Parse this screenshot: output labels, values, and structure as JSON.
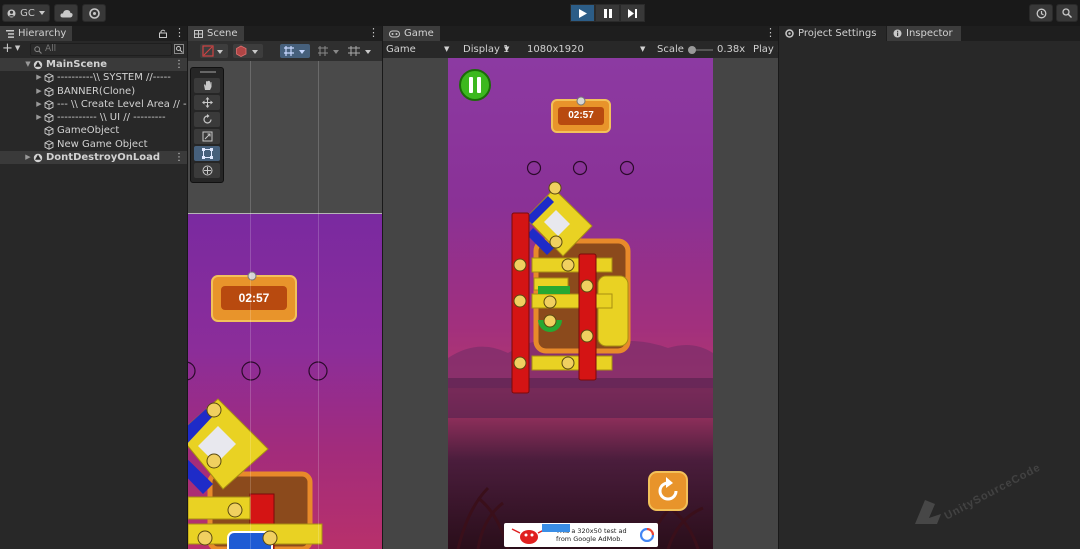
{
  "toolbar": {
    "account_label": "GC",
    "cloud_icon": "cloud-icon",
    "settings_icon": "gear-icon",
    "play_icon": "play-icon",
    "pause_icon": "pause-icon",
    "step_icon": "step-icon",
    "history_icon": "history-icon",
    "search_icon": "search-icon"
  },
  "hierarchy": {
    "tab_label": "Hierarchy",
    "search_placeholder": "All",
    "items": [
      {
        "label": "MainScene",
        "depth": 0,
        "type": "scene",
        "expanded": true
      },
      {
        "label": "----------\\\\ SYSTEM //-----",
        "depth": 1,
        "type": "object",
        "expandable": true
      },
      {
        "label": "BANNER(Clone)",
        "depth": 1,
        "type": "object",
        "expandable": true
      },
      {
        "label": "--- \\\\ Create Level Area // --",
        "depth": 1,
        "type": "object",
        "expandable": true
      },
      {
        "label": "----------- \\\\ UI // ---------",
        "depth": 1,
        "type": "object",
        "expandable": true
      },
      {
        "label": "GameObject",
        "depth": 1,
        "type": "object",
        "expandable": false
      },
      {
        "label": "New Game Object",
        "depth": 1,
        "type": "object",
        "expandable": false
      },
      {
        "label": "DontDestroyOnLoad",
        "depth": 0,
        "type": "scene",
        "expanded": false
      }
    ]
  },
  "scene": {
    "tab_label": "Scene",
    "timer": "02:57"
  },
  "game": {
    "tab_label": "Game",
    "mode": "Game",
    "display": "Display 1",
    "resolution": "1080x1920",
    "scale_label": "Scale",
    "scale_value": "0.38x",
    "play_focus": "Play F",
    "timer": "02:57",
    "ad_text": "This a 320x50 test ad\nfrom Google AdMob."
  },
  "right_panel": {
    "tab_project_settings": "Project Settings",
    "tab_inspector": "Inspector"
  },
  "watermark": "UnitySourceCode",
  "colors": {
    "accent": "#2c5d87",
    "panel": "#282828",
    "bar": "#191919"
  }
}
